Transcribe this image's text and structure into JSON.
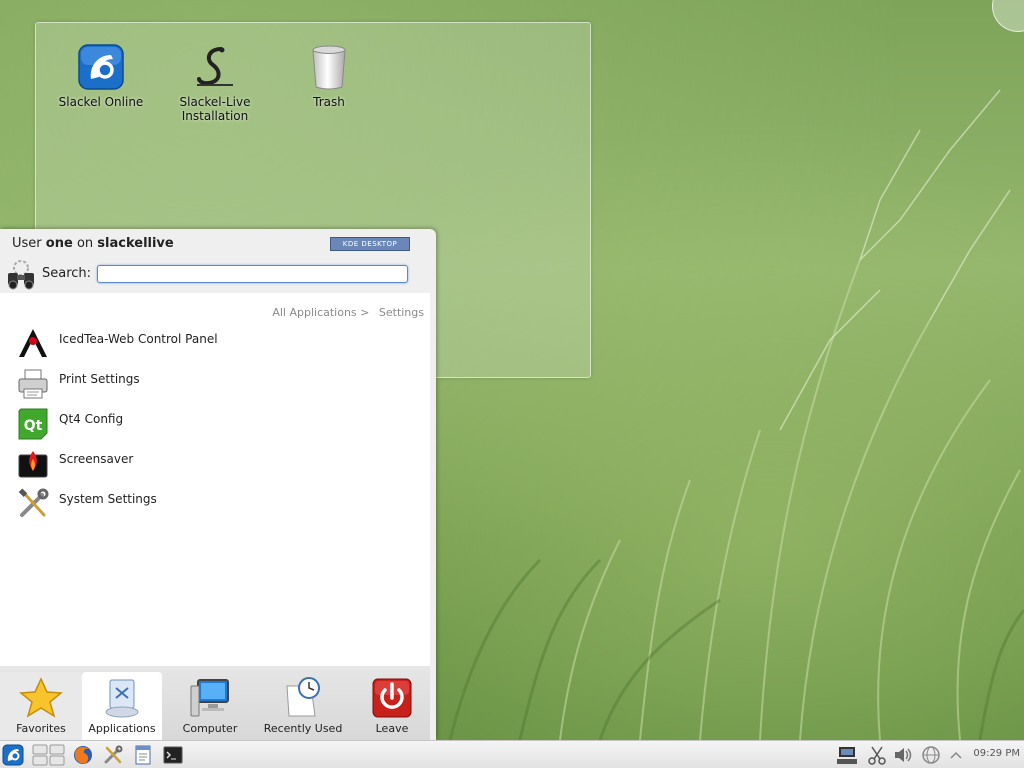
{
  "desktop": {
    "icons": [
      {
        "label": "Slackel Online"
      },
      {
        "label": "Slackel-Live Installation"
      },
      {
        "label": "Trash"
      }
    ]
  },
  "kickoff": {
    "user_prefix": "User",
    "user_name": "one",
    "user_mid": "on",
    "host_name": "slackellive",
    "badge": "KDE DESKTOP",
    "search_label": "Search:",
    "search_value": "",
    "breadcrumb": [
      "All Applications >",
      "Settings"
    ],
    "apps": [
      {
        "label": "IcedTea-Web Control Panel",
        "icon": "java-duke-icon"
      },
      {
        "label": "Print Settings",
        "icon": "printer-icon"
      },
      {
        "label": "Qt4 Config",
        "icon": "qt-icon"
      },
      {
        "label": "Screensaver",
        "icon": "screensaver-icon"
      },
      {
        "label": "System Settings",
        "icon": "tools-icon"
      }
    ],
    "tabs": [
      {
        "label": "Favorites",
        "icon": "star-icon"
      },
      {
        "label": "Applications",
        "icon": "applications-icon"
      },
      {
        "label": "Computer",
        "icon": "computer-icon"
      },
      {
        "label": "Recently Used",
        "icon": "clock-icon"
      },
      {
        "label": "Leave",
        "icon": "power-icon"
      }
    ]
  },
  "taskbar": {
    "clock": "09:29 PM"
  },
  "colors": {
    "accent": "#5a8ad6",
    "leave_red": "#c8201b",
    "slackel_blue": "#1c6fc9"
  }
}
